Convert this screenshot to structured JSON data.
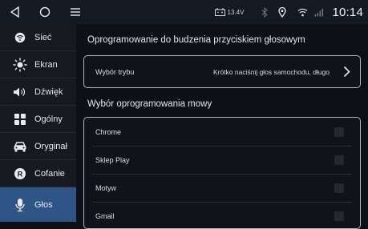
{
  "statusbar": {
    "voltage": "13.4V",
    "time": "10:14"
  },
  "sidebar": {
    "items": [
      {
        "label": "Sieć",
        "icon": "network-icon"
      },
      {
        "label": "Ekran",
        "icon": "brightness-icon"
      },
      {
        "label": "Dźwięk",
        "icon": "speaker-icon"
      },
      {
        "label": "Ogólny",
        "icon": "grid-icon"
      },
      {
        "label": "Oryginał",
        "icon": "car-icon"
      },
      {
        "label": "Cofanie",
        "icon": "reverse-icon"
      },
      {
        "label": "Głos",
        "icon": "microphone-icon"
      }
    ],
    "active_index": 6
  },
  "main": {
    "wake_title": "Oprogramowanie do budzenia przyciskiem głosowym",
    "mode": {
      "label": "Wybór trybu",
      "value": "Krótko naciśnij głos samochodu, długo"
    },
    "voice_title": "Wybór oprogramowania mowy",
    "apps": [
      {
        "name": "Chrome",
        "checked": false
      },
      {
        "name": "Sklep Play",
        "checked": false
      },
      {
        "name": "Motyw",
        "checked": false
      },
      {
        "name": "Gmail",
        "checked": false
      }
    ]
  },
  "colors": {
    "active_bg": "#2f5486",
    "background": "#0d1116",
    "panel_border": "#aeb4bd"
  }
}
